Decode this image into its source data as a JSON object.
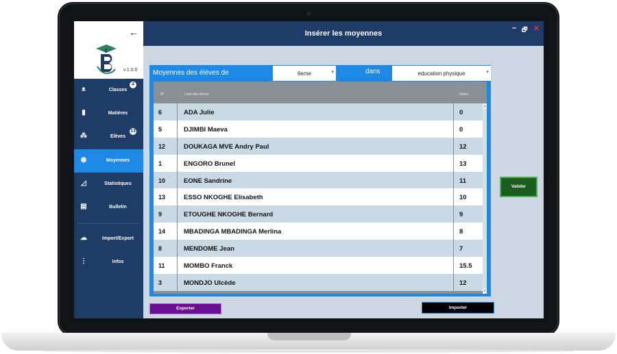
{
  "header": {
    "title": "Insérer les moyennes",
    "minimize": "–",
    "restore": "🗗",
    "close": "✕"
  },
  "sidebar": {
    "back_icon": "arrow-left-icon",
    "version": "v.1.0.0",
    "items": [
      {
        "label": "Classes",
        "icon": "people-icon",
        "badge": "4"
      },
      {
        "label": "Matières",
        "icon": "book-icon",
        "badge": ""
      },
      {
        "label": "Elèves",
        "icon": "group-icon",
        "badge": "13"
      },
      {
        "label": "Moyennes",
        "icon": "moyennes-icon",
        "badge": ""
      },
      {
        "label": "Statistiques",
        "icon": "chart-icon",
        "badge": ""
      },
      {
        "label": "Bulletin",
        "icon": "document-icon",
        "badge": ""
      },
      {
        "label": "Import/Export",
        "icon": "cloud-icon",
        "badge": ""
      },
      {
        "label": "Infos",
        "icon": "more-vertical-icon",
        "badge": ""
      }
    ],
    "active": "Moyennes"
  },
  "filter": {
    "label": "Moyennes des élèves de",
    "class_value": "6eme",
    "dans_label": "dans",
    "subject_value": "education physique"
  },
  "table": {
    "columns": {
      "no": "N°",
      "name": "Liste des élèves",
      "note": "Notes"
    },
    "rows": [
      {
        "no": "6",
        "name": "ADA Julie",
        "note": "0"
      },
      {
        "no": "5",
        "name": "DJIMBI Maeva",
        "note": "0"
      },
      {
        "no": "12",
        "name": "DOUKAGA MVE Andry Paul",
        "note": "12"
      },
      {
        "no": "1",
        "name": "ENGORO Brunel",
        "note": "13"
      },
      {
        "no": "10",
        "name": "EONE Sandrine",
        "note": "11"
      },
      {
        "no": "13",
        "name": "ESSO NKOGHE Elisabeth",
        "note": "10"
      },
      {
        "no": "9",
        "name": "ETOUGHE NKOGHE Bernard",
        "note": "9"
      },
      {
        "no": "14",
        "name": "MBADINGA MBADINGA Merlina",
        "note": "8"
      },
      {
        "no": "8",
        "name": "MENDOME Jean",
        "note": "7"
      },
      {
        "no": "11",
        "name": "MOMBO  Franck",
        "note": "15.5"
      },
      {
        "no": "3",
        "name": "MONDJO Ulcède",
        "note": "12"
      }
    ]
  },
  "buttons": {
    "valider": "Valider",
    "exporter": "Exporter",
    "importer": "Importer"
  },
  "colors": {
    "sidebar": "#1f3b67",
    "accent": "#1e88e5",
    "valider": "#1b5e20",
    "exporter": "#6a0d91",
    "importer": "#000000"
  }
}
